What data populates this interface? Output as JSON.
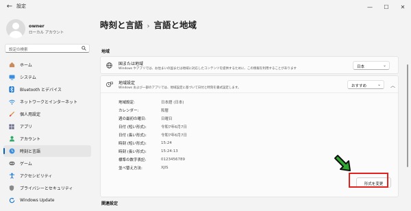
{
  "window": {
    "title": "設定",
    "back_icon": "back-arrow-icon",
    "controls": [
      "—",
      "☐",
      "✕"
    ]
  },
  "profile": {
    "name": "owner",
    "type": "ローカル アカウント"
  },
  "search": {
    "placeholder": "設定の検索"
  },
  "nav": {
    "items": [
      {
        "label": "ホーム",
        "icon": "home-icon"
      },
      {
        "label": "システム",
        "icon": "system-icon"
      },
      {
        "label": "Bluetooth とデバイス",
        "icon": "bluetooth-icon"
      },
      {
        "label": "ネットワークとインターネット",
        "icon": "network-icon"
      },
      {
        "label": "個人用設定",
        "icon": "brush-icon"
      },
      {
        "label": "アプリ",
        "icon": "apps-icon"
      },
      {
        "label": "アカウント",
        "icon": "account-icon"
      },
      {
        "label": "時刻と言語",
        "icon": "time-language-icon",
        "active": true
      },
      {
        "label": "ゲーム",
        "icon": "game-icon"
      },
      {
        "label": "アクセシビリティ",
        "icon": "accessibility-icon"
      },
      {
        "label": "プライバシーとセキュリティ",
        "icon": "shield-icon"
      },
      {
        "label": "Windows Update",
        "icon": "update-icon"
      }
    ]
  },
  "main": {
    "breadcrumb_parent": "時刻と言語",
    "breadcrumb_sep": "›",
    "breadcrumb_current": "言語と地域",
    "section_region": "地域",
    "section_related": "関連設定",
    "country": {
      "title": "国または地域",
      "subtitle": "Windows やアプリでは、お住まいの国または地域に対応したコンテンツを提供するために、この情報を利用することがあります",
      "value": "日本"
    },
    "region_format": {
      "title": "地域設定",
      "subtitle": "Windows および一部のアプリでは、地域設定に基づいて日付と時刻を書式設定します。",
      "value": "おすすめ",
      "rows": [
        {
          "key": "地域設定:",
          "value": "日本語 (日本)"
        },
        {
          "key": "カレンダー:",
          "value": "和暦"
        },
        {
          "key": "週の最初の曜日:",
          "value": "日曜日"
        },
        {
          "key": "日付 (短い形式):",
          "value": "令和7年6月7日"
        },
        {
          "key": "日付 (長い形式):",
          "value": "令和7年6月7日"
        },
        {
          "key": "時刻 (短い形式):",
          "value": "15:24"
        },
        {
          "key": "時刻 (長い形式):",
          "value": "15:24:13"
        },
        {
          "key": "標準の数字表記:",
          "value": "0123456789"
        },
        {
          "key": "並べ替え方法:",
          "value": "XJIS"
        }
      ],
      "change_button": "形式を変更"
    }
  },
  "colors": {
    "accent": "#005fb8",
    "highlight_red": "#e2211c",
    "arrow_green": "#2fa82f"
  }
}
